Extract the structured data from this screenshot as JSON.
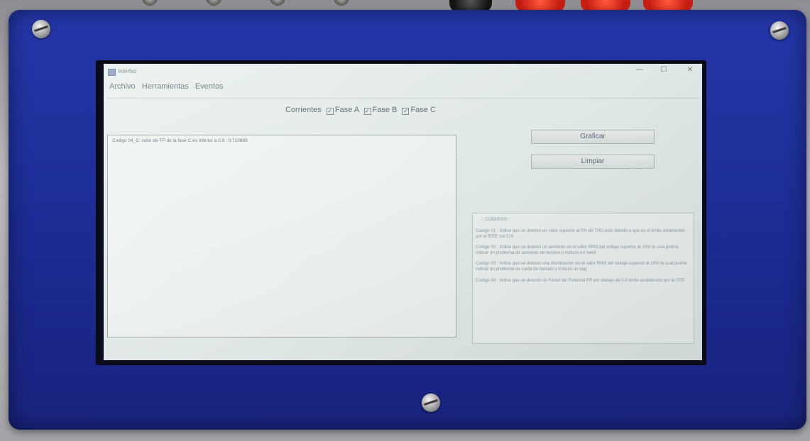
{
  "window": {
    "title": "Interfaz",
    "minimize_glyph": "—",
    "maximize_glyph": "☐",
    "close_glyph": "✕"
  },
  "menu": [
    "Archivo",
    "Herramientas",
    "Eventos"
  ],
  "filters": {
    "label": "Corrientes",
    "options": [
      {
        "label": "Fase A",
        "checked": true
      },
      {
        "label": "Fase B",
        "checked": true
      },
      {
        "label": "Fase C",
        "checked": true
      }
    ]
  },
  "log": {
    "entries": [
      "Codigo 04_C: valor de FP de la fase C es Inferior a 0.9  :  0.710885"
    ]
  },
  "buttons": {
    "plot": "Graficar",
    "clear": "Limpiar"
  },
  "codes": {
    "title": ":::CODIGOS:::",
    "items": [
      "Codigo 01 : Indica que se detecto un valor superior al 5% de THD esto debido a que es el limite establecido por el IEEE std 519",
      "Codigo 02 : Indica que se detecto un aumento en el valor RMS del voltaje superior al 10% lo cual podria indicar un problema de aumento de tension o incluso un swell",
      "Codigo 03 : Indica que se detecto una disminucion en el valor RMS del voltaje superior al 10% lo cual podria indicar un problema de caida de tension o incluso un sag",
      "Codigo 04 : Indica que se detecto un Factor de Potencia FP por debajo de 0.9 limite establecido por la CFE"
    ]
  },
  "icons": [
    "app-icon",
    "checkbox-icon",
    "screw-icon"
  ],
  "colors": {
    "enclosure": "#1f2f9c",
    "screen": "#e4ecea",
    "knob_red": "#d3281a"
  }
}
